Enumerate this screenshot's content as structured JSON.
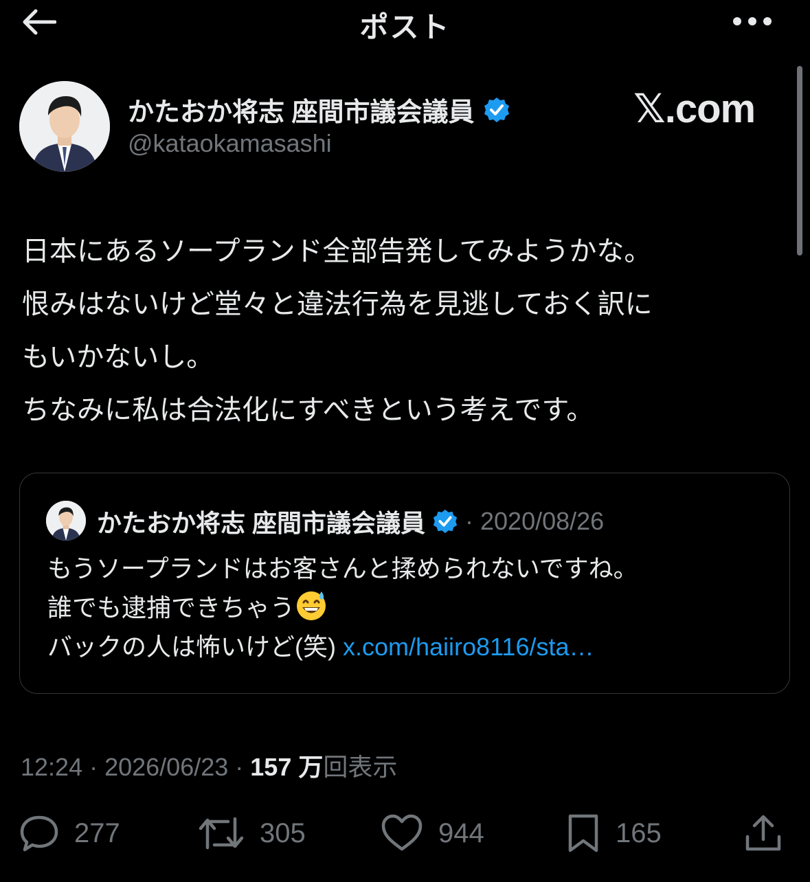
{
  "header": {
    "title": "ポスト"
  },
  "author": {
    "display_name": "かたおか将志 座間市議会議員",
    "handle": "@kataokamasashi",
    "verified": true
  },
  "watermark": "𝕏.com",
  "post": {
    "text": "日本にあるソープランド全部告発してみようかな。\n恨みはないけど堂々と違法行為を見逃しておく訳に\nもいかないし。\nちなみに私は合法化にすべきという考えです。"
  },
  "quote": {
    "display_name": "かたおか将志 座間市議会議員",
    "separator": "·",
    "date": "2020/08/26",
    "text_line1": "もうソープランドはお客さんと揉められないですね。",
    "text_line2": "誰でも逮捕できちゃう",
    "text_line3": "バックの人は怖いけど(笑) ",
    "link": "x.com/haiiro8116/sta…",
    "emoji": "grinning-face-with-sweat"
  },
  "meta": {
    "time": "12:24",
    "date": "2026/06/23",
    "views_count": "157 万",
    "views_label": "回表示",
    "separator": " · "
  },
  "actions": {
    "replies": "277",
    "reposts": "305",
    "likes": "944",
    "bookmarks": "165"
  },
  "colors": {
    "background": "#000000",
    "text": "#e7e9ea",
    "muted": "#71767b",
    "link": "#1d9bf0",
    "verified": "#1d9bf0"
  }
}
